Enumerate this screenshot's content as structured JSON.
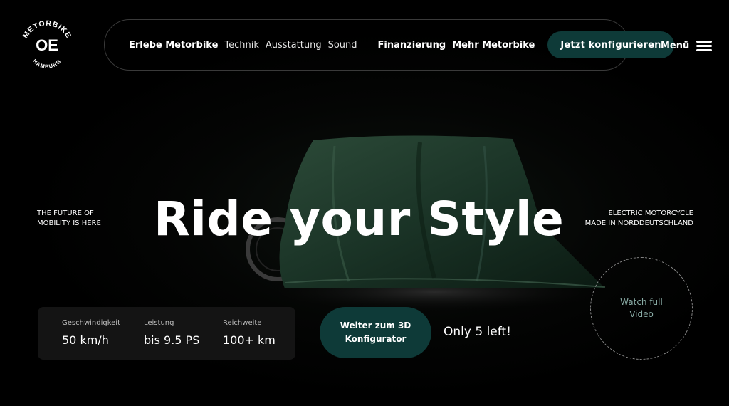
{
  "brand": {
    "top_text": "METORBIKE",
    "mark": "OE",
    "bottom_text": "HAMBURG"
  },
  "nav": {
    "links": [
      {
        "label": "Erlebe Metorbike",
        "bold": true
      },
      {
        "label": "Technik",
        "bold": false
      },
      {
        "label": "Ausstattung",
        "bold": false
      },
      {
        "label": "Sound",
        "bold": false
      },
      {
        "label": "Finanzierung",
        "bold": true
      },
      {
        "label": "Mehr Metorbike",
        "bold": true
      }
    ],
    "cta_label": "Jetzt konfigurieren",
    "menu_label": "Menü"
  },
  "hero": {
    "headline": "Ride your Style",
    "left_line1": "THE FUTURE OF",
    "left_line2": "MOBILITY IS HERE",
    "right_line1": "ELECTRIC MOTORCYCLE",
    "right_line2": "MADE IN NORDDEUTSCHLAND"
  },
  "stats": [
    {
      "label": "Geschwindigkeit",
      "value": "50 km/h"
    },
    {
      "label": "Leistung",
      "value": "bis 9.5 PS"
    },
    {
      "label": "Reichweite",
      "value": "100+ km"
    }
  ],
  "configurator": {
    "line1": "Weiter zum 3D",
    "line2": "Konfigurator"
  },
  "stock_text": "Only 5 left!",
  "video": {
    "line1": "Watch full",
    "line2": "Video"
  },
  "colors": {
    "background": "#000000",
    "accent_teal": "#0e3a38",
    "cloth_green": "#1e3a2c",
    "video_text": "#87a9a3"
  }
}
